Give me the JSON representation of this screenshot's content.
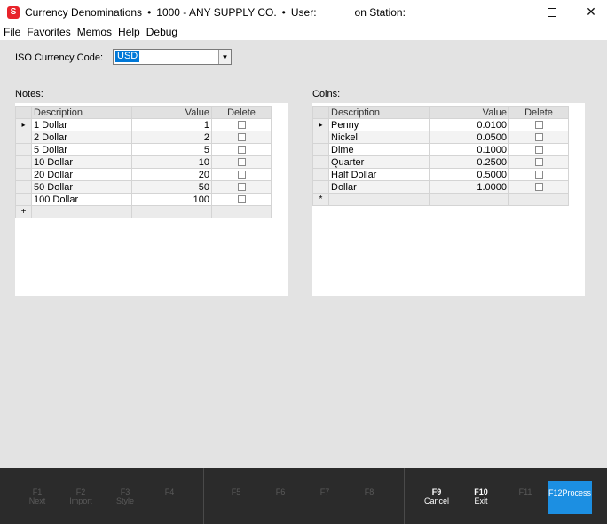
{
  "titlebar": {
    "app_icon_label": "S",
    "title": "Currency Denominations",
    "separator": "•",
    "company": "1000 - ANY SUPPLY CO.",
    "user_label": "User:",
    "station_label": "on Station:"
  },
  "menu": [
    "File",
    "Favorites",
    "Memos",
    "Help",
    "Debug"
  ],
  "iso": {
    "label": "ISO Currency Code:",
    "value": "USD"
  },
  "notes": {
    "label": "Notes:",
    "columns": [
      "Description",
      "Value",
      "Delete"
    ],
    "rows": [
      {
        "description": "1 Dollar",
        "value": "1"
      },
      {
        "description": "2 Dollar",
        "value": "2"
      },
      {
        "description": "5 Dollar",
        "value": "5"
      },
      {
        "description": "10 Dollar",
        "value": "10"
      },
      {
        "description": "20 Dollar",
        "value": "20"
      },
      {
        "description": "50 Dollar",
        "value": "50"
      },
      {
        "description": "100 Dollar",
        "value": "100"
      }
    ],
    "new_row_marker": "+"
  },
  "coins": {
    "label": "Coins:",
    "columns": [
      "Description",
      "Value",
      "Delete"
    ],
    "rows": [
      {
        "description": "Penny",
        "value": "0.0100"
      },
      {
        "description": "Nickel",
        "value": "0.0500"
      },
      {
        "description": "Dime",
        "value": "0.1000"
      },
      {
        "description": "Quarter",
        "value": "0.2500"
      },
      {
        "description": "Half Dollar",
        "value": "0.5000"
      },
      {
        "description": "Dollar",
        "value": "1.0000"
      }
    ],
    "new_row_marker": "*"
  },
  "fkeys": [
    {
      "key": "F1",
      "label": "Next",
      "enabled": false
    },
    {
      "key": "F2",
      "label": "Import",
      "enabled": false
    },
    {
      "key": "F3",
      "label": "Style",
      "enabled": false
    },
    {
      "key": "F4",
      "label": "",
      "enabled": false
    },
    {
      "key": "F5",
      "label": "",
      "enabled": false
    },
    {
      "key": "F6",
      "label": "",
      "enabled": false
    },
    {
      "key": "F7",
      "label": "",
      "enabled": false
    },
    {
      "key": "F8",
      "label": "",
      "enabled": false
    },
    {
      "key": "F9",
      "label": "Cancel",
      "enabled": true
    },
    {
      "key": "F10",
      "label": "Exit",
      "enabled": true
    },
    {
      "key": "F11",
      "label": "",
      "enabled": false
    },
    {
      "key": "F12",
      "label": "Process",
      "enabled": true
    }
  ],
  "colors": {
    "accent": "#1c8fe2",
    "selection": "#0078d7",
    "app_icon": "#e8232a",
    "fkeybar": "#2b2b2b"
  }
}
